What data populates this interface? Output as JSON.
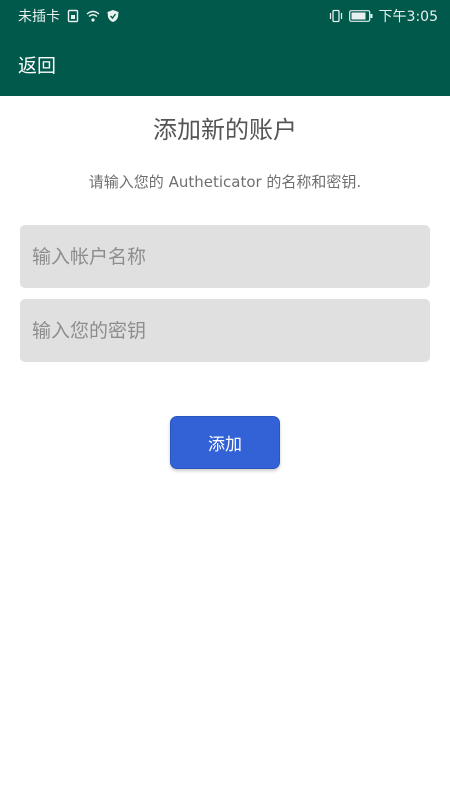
{
  "status_bar": {
    "carrier": "未插卡",
    "time": "下午3:05",
    "icons": [
      "sim-icon",
      "wifi-icon",
      "shield-icon",
      "vibrate-icon",
      "battery-icon"
    ]
  },
  "app_bar": {
    "back_label": "返回",
    "color": "#00594b"
  },
  "main": {
    "title": "添加新的账户",
    "subtitle": "请输入您的 Autheticator 的名称和密钥.",
    "account_name_placeholder": "输入帐户名称",
    "secret_placeholder": "输入您的密钥",
    "add_label": "添加",
    "accent": "#3262d6"
  }
}
